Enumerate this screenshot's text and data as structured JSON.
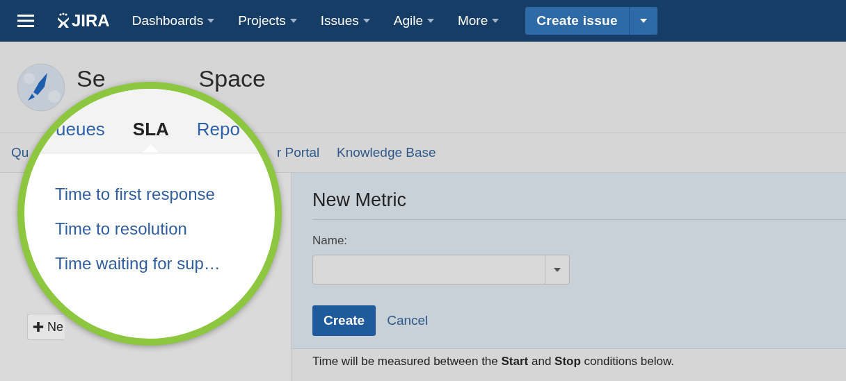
{
  "header": {
    "logo": "JIRA",
    "nav": [
      {
        "label": "Dashboards"
      },
      {
        "label": "Projects"
      },
      {
        "label": "Issues"
      },
      {
        "label": "Agile"
      },
      {
        "label": "More"
      }
    ],
    "create_button": "Create issue"
  },
  "project": {
    "title_parts": [
      "Se",
      "Space"
    ]
  },
  "subnav": [
    "Qu",
    "r Portal",
    "Knowledge Base"
  ],
  "sidebar": {
    "new_button": "Ne"
  },
  "metric_form": {
    "title": "New Metric",
    "name_label": "Name:",
    "create_button": "Create",
    "cancel_link": "Cancel",
    "note": "Time will be measured between the **Start** and **Stop** conditions below."
  },
  "magnifier": {
    "tabs": [
      {
        "label": "ueues",
        "selected": false
      },
      {
        "label": "SLA",
        "selected": true
      },
      {
        "label": "Repo",
        "selected": false
      }
    ],
    "links": [
      "Time to first response",
      "Time to resolution",
      "Time waiting for sup…"
    ]
  }
}
